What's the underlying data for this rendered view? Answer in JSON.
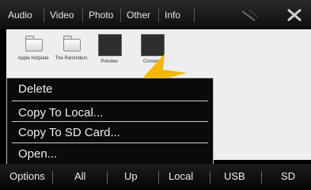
{
  "tabs": [
    "Audio",
    "Video",
    "Photo",
    "Other",
    "Info"
  ],
  "files": [
    {
      "name": "Apple Hotplate",
      "type": "folder"
    },
    {
      "name": "The Reminders",
      "type": "folder"
    },
    {
      "name": "Preview",
      "type": "photo"
    },
    {
      "name": "Concept",
      "type": "photo"
    }
  ],
  "context_menu": {
    "items": [
      "Delete",
      "Copy To Local...",
      "Copy To SD Card...",
      "Open..."
    ]
  },
  "bottom_bar": {
    "buttons": [
      "Options",
      "All",
      "Up",
      "Local",
      "USB",
      "SD"
    ]
  },
  "colors": {
    "accent_arrow": "#f5b800",
    "menu_bg": "#0a0a0a",
    "panel_bg": "#eeeeee"
  },
  "icons": {
    "top_bar_right_1": "signal-icon",
    "top_bar_right_2": "close-icon",
    "pointer": "arrow-pointer-icon"
  }
}
